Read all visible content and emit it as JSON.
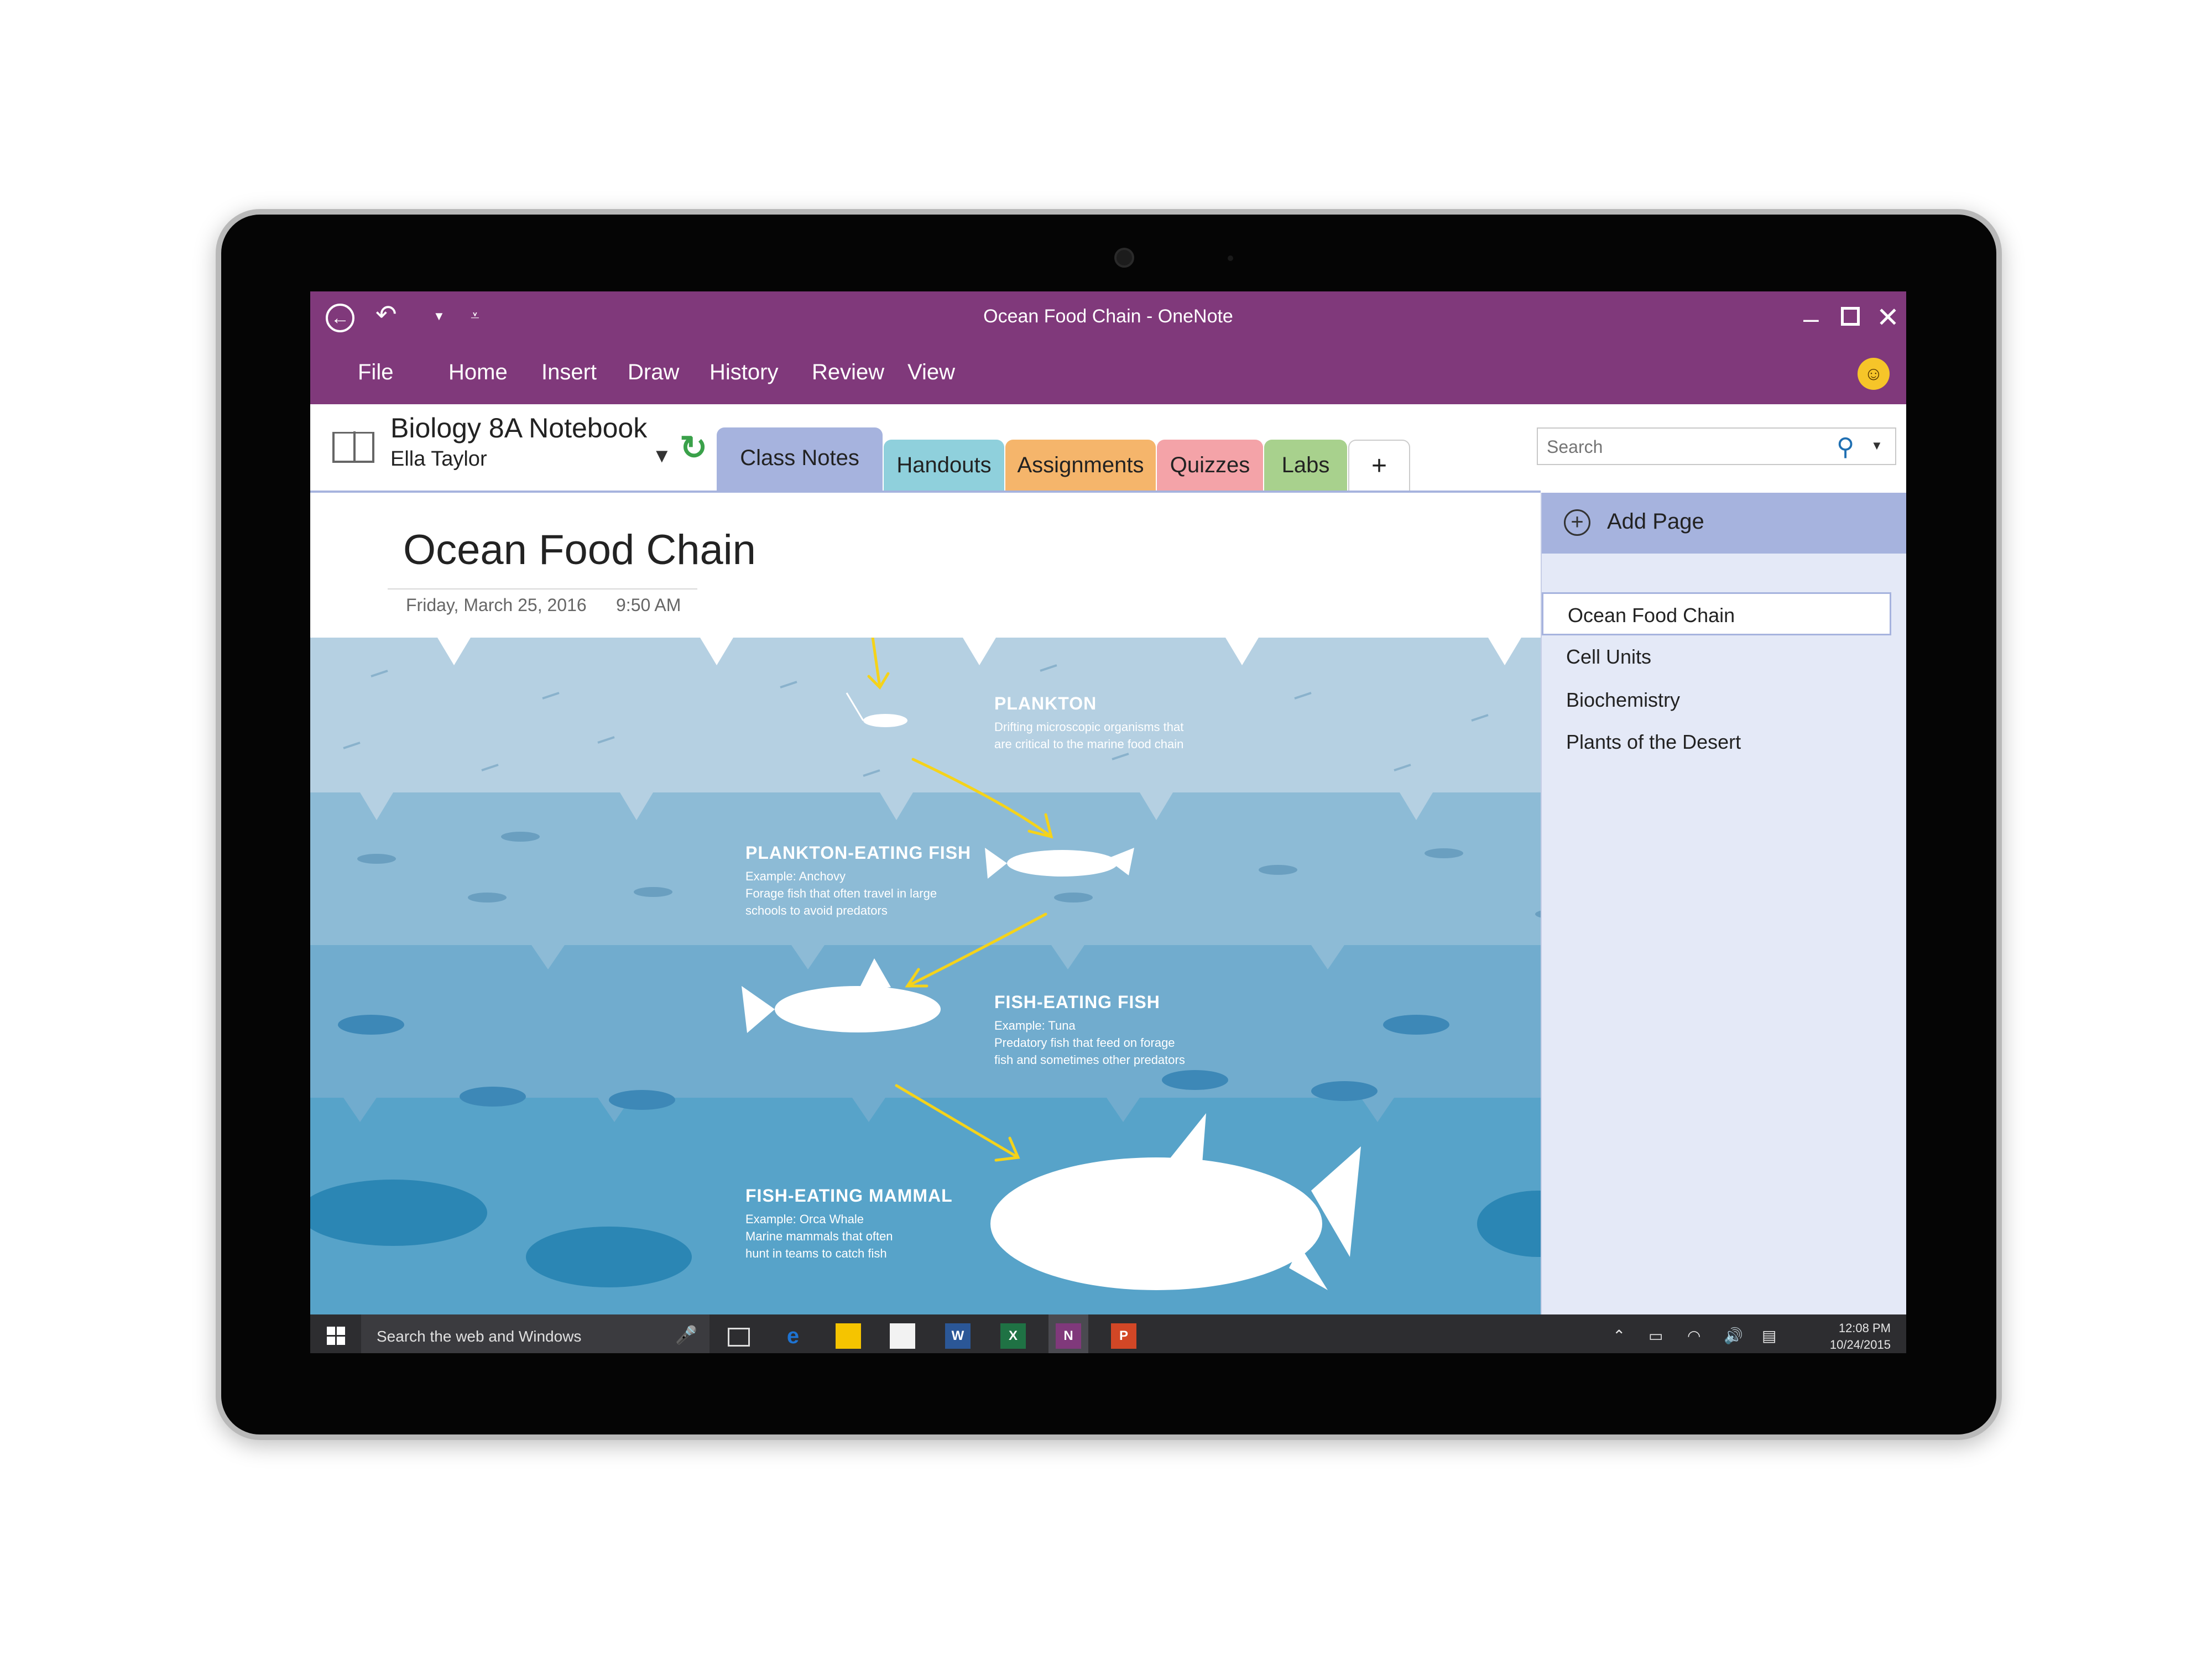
{
  "window": {
    "title": "Ocean Food Chain - OneNote"
  },
  "menu": {
    "items": [
      "File",
      "Home",
      "Insert",
      "Draw",
      "History",
      "Review",
      "View"
    ]
  },
  "notebook": {
    "name": "Biology 8A Notebook",
    "user": "Ella Taylor"
  },
  "sections": [
    {
      "label": "Class Notes",
      "color": "#a6b3de"
    },
    {
      "label": "Handouts",
      "color": "#8fd0dc"
    },
    {
      "label": "Assignments",
      "color": "#f5b56b"
    },
    {
      "label": "Quizzes",
      "color": "#f4a3a8"
    },
    {
      "label": "Labs",
      "color": "#a8d18d"
    },
    {
      "label": "+",
      "color": "#ffffff"
    }
  ],
  "search": {
    "placeholder": "Search"
  },
  "page": {
    "title": "Ocean Food Chain",
    "date": "Friday, March 25, 2016",
    "time": "9:50 AM"
  },
  "infographic": {
    "bands": [
      {
        "title": "PLANKTON",
        "lines": [
          "Drifting microscopic organisms that",
          "are critical to the marine food chain"
        ],
        "color": "#b5d0e2"
      },
      {
        "title": "PLANKTON-EATING FISH",
        "lines": [
          "Example: Anchovy",
          "Forage fish that often travel in large",
          "schools to avoid predators"
        ],
        "color": "#8dbbd6"
      },
      {
        "title": "FISH-EATING FISH",
        "lines": [
          "Example: Tuna",
          "Predatory fish that feed on forage",
          "fish and sometimes other predators"
        ],
        "color": "#71acce"
      },
      {
        "title": "FISH-EATING MAMMAL",
        "lines": [
          "Example: Orca Whale",
          "Marine mammals that often",
          "hunt in teams to catch fish"
        ],
        "color": "#57a3c9"
      }
    ],
    "ink_color": "#f5d31a"
  },
  "pages_pane": {
    "add_label": "Add Page",
    "pages": [
      "Ocean Food Chain",
      "Cell Units",
      "Biochemistry",
      "Plants of the Desert"
    ],
    "selected_index": 0
  },
  "taskbar": {
    "search_text": "Search the web and Windows",
    "time": "12:08 PM",
    "date": "10/24/2015",
    "apps": [
      {
        "name": "edge-icon",
        "letter": "e",
        "color": "#1e73d2"
      },
      {
        "name": "file-explorer-icon",
        "letter": "",
        "color": "#f5c400"
      },
      {
        "name": "store-icon",
        "letter": "",
        "color": "#f2f2f2"
      },
      {
        "name": "word-icon",
        "letter": "W",
        "color": "#2b5797"
      },
      {
        "name": "excel-icon",
        "letter": "X",
        "color": "#1f7244"
      },
      {
        "name": "onenote-icon",
        "letter": "N",
        "color": "#80397b"
      },
      {
        "name": "powerpoint-icon",
        "letter": "P",
        "color": "#d24726"
      }
    ]
  },
  "colors": {
    "onenote_purple": "#80397b",
    "accent_blue": "#a6b3de"
  }
}
